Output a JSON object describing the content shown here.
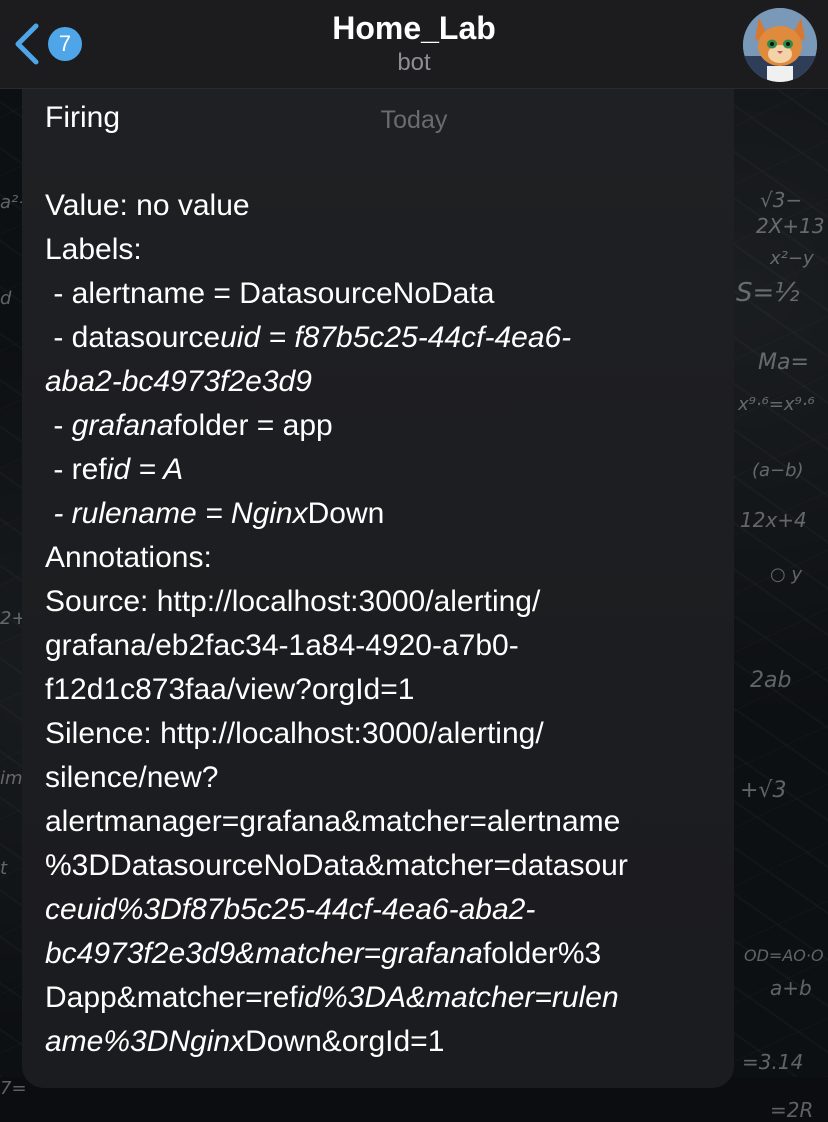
{
  "header": {
    "title": "Home_Lab",
    "subtitle": "bot",
    "back_badge": "7",
    "back_icon": "chevron-left-icon",
    "avatar": "cat-avatar"
  },
  "date_chip": "Today",
  "message": {
    "lines": [
      [
        {
          "t": "Firing"
        }
      ],
      [
        {
          "t": ""
        }
      ],
      [
        {
          "t": "Value: no value"
        }
      ],
      [
        {
          "t": "Labels:"
        }
      ],
      [
        {
          "t": " - alertname = DatasourceNoData"
        }
      ],
      [
        {
          "t": " - datasource"
        },
        {
          "t": "uid = f87b5c25-44cf-4ea6-",
          "i": true
        }
      ],
      [
        {
          "t": "aba2-bc4973f2e3d9",
          "i": true
        }
      ],
      [
        {
          "t": " - "
        },
        {
          "t": "grafana",
          "i": true
        },
        {
          "t": "folder = app"
        }
      ],
      [
        {
          "t": " - ref"
        },
        {
          "t": "id = A",
          "i": true
        }
      ],
      [
        {
          "t": " - rulename = Nginx",
          "i": true
        },
        {
          "t": "Down"
        }
      ],
      [
        {
          "t": "Annotations:"
        }
      ],
      [
        {
          "t": "Source: http://localhost:3000/alerting/"
        }
      ],
      [
        {
          "t": "grafana/eb2fac34-1a84-4920-a7b0-"
        }
      ],
      [
        {
          "t": "f12d1c873faa/view?orgId=1"
        }
      ],
      [
        {
          "t": "Silence: http://localhost:3000/alerting/"
        }
      ],
      [
        {
          "t": "silence/new?"
        }
      ],
      [
        {
          "t": "alertmanager=grafana&matcher=alertname"
        }
      ],
      [
        {
          "t": "%3DDatasourceNoData&matcher=datasour"
        }
      ],
      [
        {
          "t": "ceuid%3Df87b5c25-44cf-4ea6-aba2-",
          "i": true
        }
      ],
      [
        {
          "t": "bc4973f2e3d9&matcher=grafana",
          "i": true
        },
        {
          "t": "folder%3"
        }
      ],
      [
        {
          "t": "Dapp&matcher=ref"
        },
        {
          "t": "id%3DA&matcher=rulen",
          "i": true
        }
      ],
      [
        {
          "t": "ame%3DNginx",
          "i": true
        },
        {
          "t": "Down&orgId=1"
        }
      ]
    ]
  }
}
